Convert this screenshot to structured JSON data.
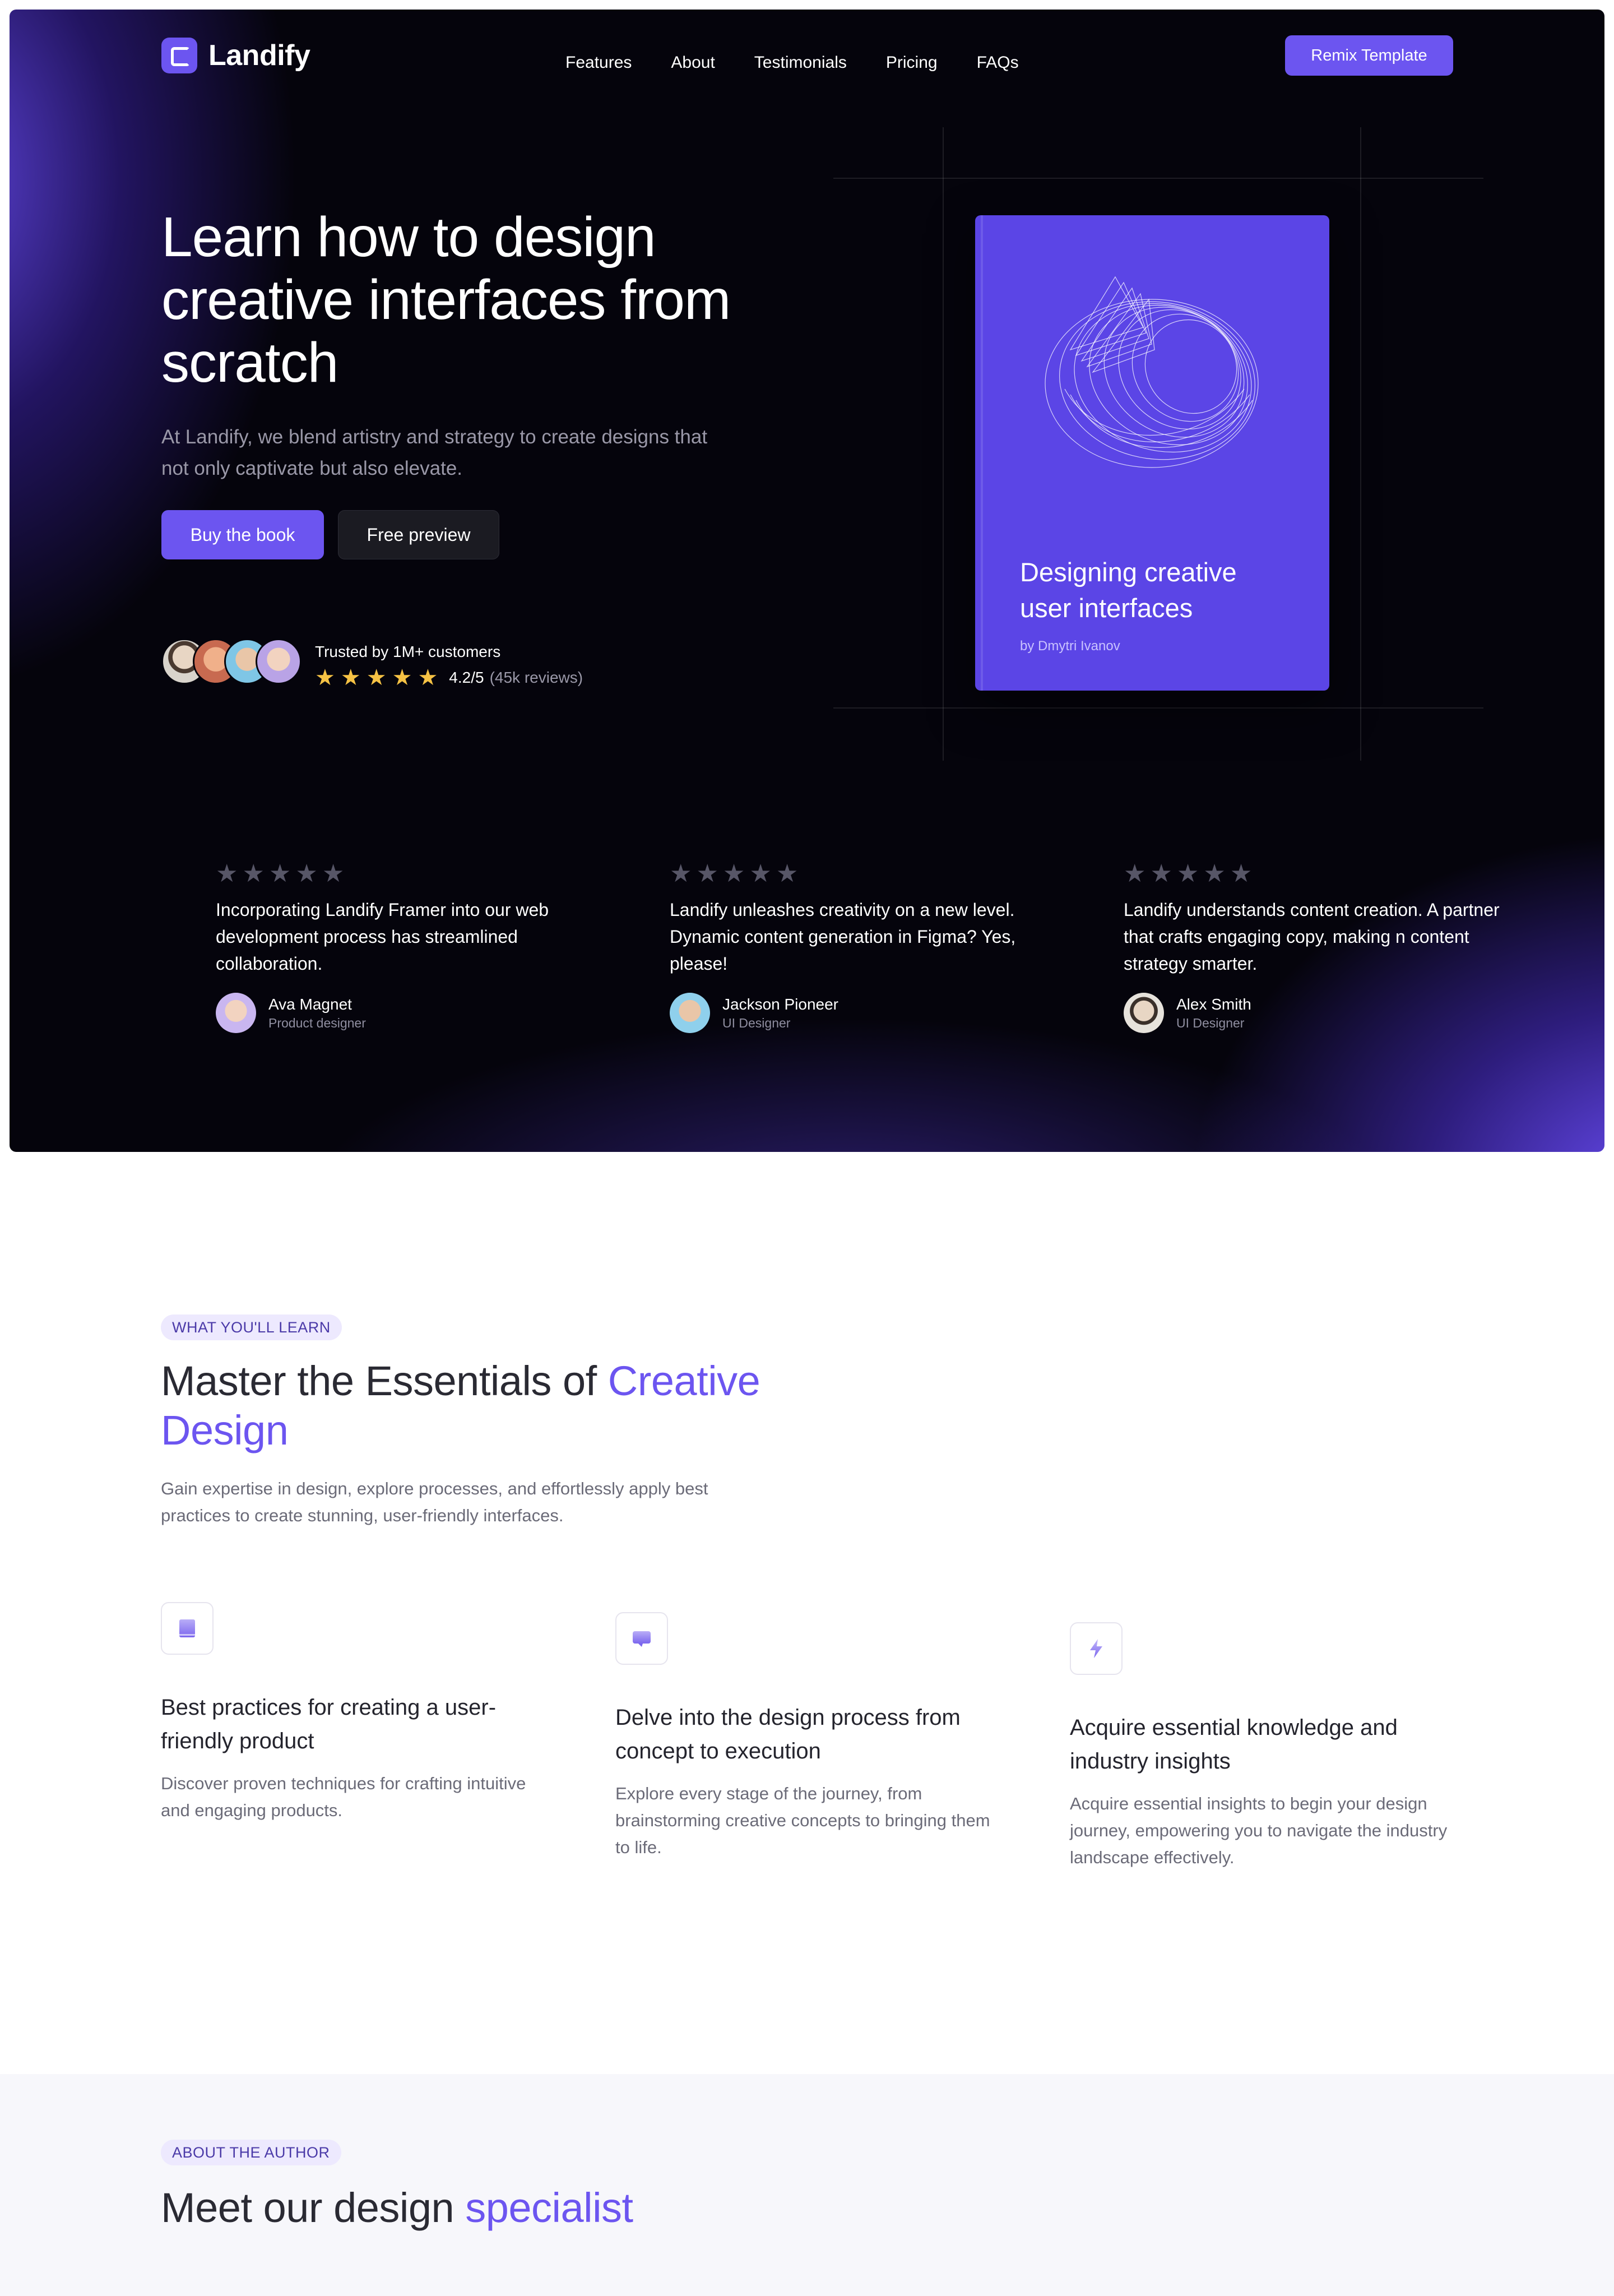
{
  "nav": {
    "brand": "Landify",
    "links": [
      "Features",
      "About",
      "Testimonials",
      "Pricing",
      "FAQs"
    ],
    "cta": "Remix Template"
  },
  "hero": {
    "title": "Learn how to design creative interfaces from scratch",
    "subtitle": "At Landify, we blend artistry and strategy to create designs that not only captivate but also elevate.",
    "primary_button": "Buy the book",
    "secondary_button": "Free preview",
    "trusted_text": "Trusted by 1M+ customers",
    "rating_value": "4.2/5",
    "rating_count": "(45k reviews)",
    "rating_stars": 5
  },
  "book": {
    "title": "Designing creative user interfaces",
    "author": "by Dmytri Ivanov"
  },
  "testimonials": [
    {
      "quote": "Incorporating Landify Framer into our web development process has streamlined collaboration.",
      "name": "Ava Magnet",
      "role": "Product designer"
    },
    {
      "quote": "Landify unleashes creativity on a new level. Dynamic content generation in Figma? Yes, please!",
      "name": "Jackson Pioneer",
      "role": "UI Designer"
    },
    {
      "quote": "Landify understands content creation. A partner that crafts engaging copy, making n content strategy smarter.",
      "name": "Alex Smith",
      "role": "UI Designer"
    }
  ],
  "learn": {
    "badge": "WHAT YOU'LL LEARN",
    "title_plain": "Master the Essentials of ",
    "title_accent": "Creative Design",
    "subtitle": "Gain expertise in design, explore processes, and effortlessly apply best practices to create stunning, user-friendly interfaces.",
    "features": [
      {
        "icon": "book-icon",
        "title": "Best practices for creating a user-friendly product",
        "text": "Discover proven techniques for crafting intuitive and engaging products."
      },
      {
        "icon": "chat-icon",
        "title": "Delve into the design process from concept to execution",
        "text": "Explore every stage of the journey, from brainstorming creative concepts to bringing them to life."
      },
      {
        "icon": "lightning-icon",
        "title": "Acquire essential knowledge and industry insights",
        "text": "Acquire essential insights to begin your design journey, empowering you to navigate the industry landscape effectively."
      }
    ]
  },
  "author": {
    "badge": "ABOUT THE AUTHOR",
    "title_plain": "Meet our design ",
    "title_accent": "specialist"
  },
  "colors": {
    "accent": "#6c55f0",
    "hero_bg": "#05040c",
    "star": "#f6c244"
  }
}
